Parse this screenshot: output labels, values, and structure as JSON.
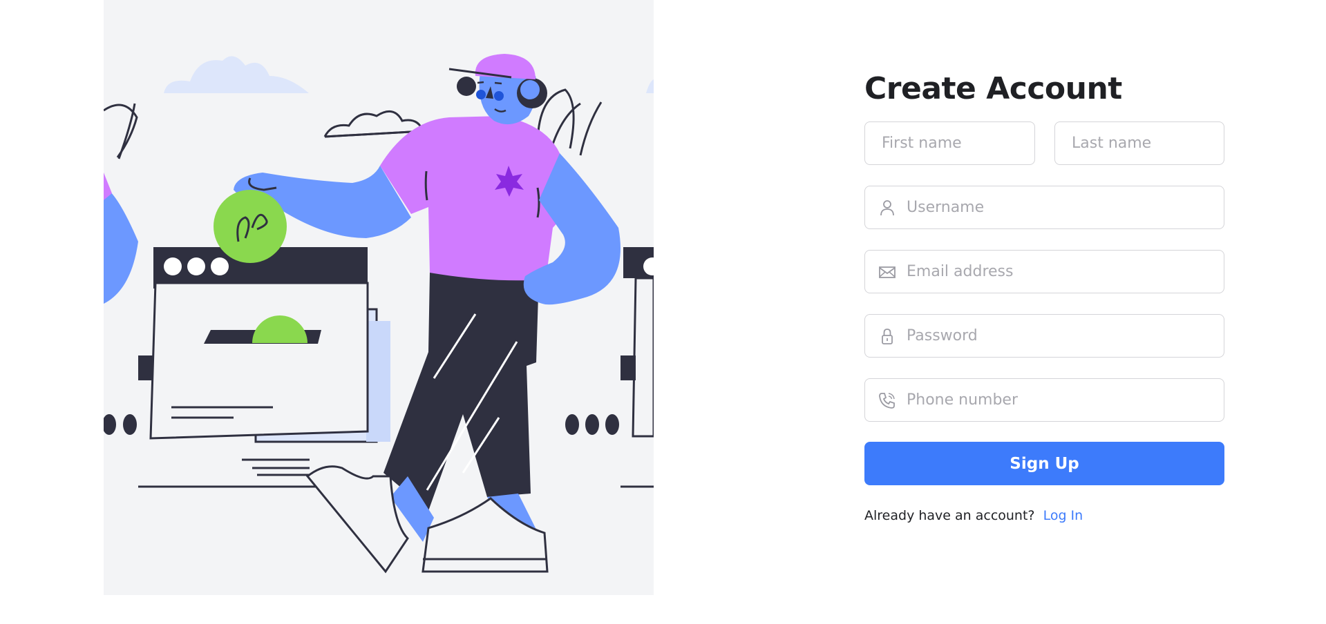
{
  "title": "Create Account",
  "fields": {
    "first_name": {
      "placeholder": "First name",
      "value": ""
    },
    "last_name": {
      "placeholder": "Last name",
      "value": ""
    },
    "username": {
      "placeholder": "Username",
      "value": "",
      "icon": "user-icon"
    },
    "email": {
      "placeholder": "Email address",
      "value": "",
      "icon": "envelope-icon"
    },
    "password": {
      "placeholder": "Password",
      "value": "",
      "icon": "lock-icon"
    },
    "phone": {
      "placeholder": "Phone number",
      "value": "",
      "icon": "phone-icon"
    }
  },
  "signup_label": "Sign Up",
  "footer": {
    "prompt": "Already have an account?",
    "login_link": "Log In"
  },
  "colors": {
    "accent": "#3d7bfb",
    "illustration_purple": "#d07bff",
    "illustration_blue": "#6c98ff",
    "illustration_green": "#8ad84e",
    "illustration_dark": "#2f3040",
    "hero_background": "#f3f4f6"
  },
  "illustration": {
    "description_icon": "person-with-coin-illustration"
  }
}
